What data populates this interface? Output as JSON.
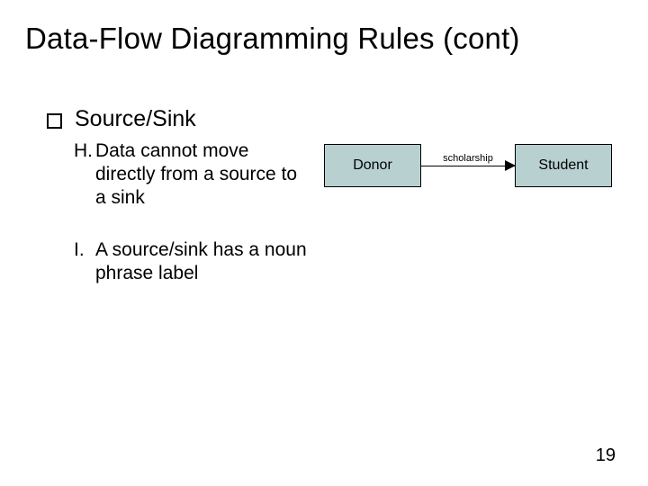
{
  "title": "Data-Flow Diagramming Rules (cont)",
  "bullet": {
    "label": "Source/Sink"
  },
  "items": {
    "H": {
      "letter": "H.",
      "text": "Data cannot move directly from a source to a sink"
    },
    "I": {
      "letter": "I.",
      "text": "A source/sink has a noun phrase label"
    }
  },
  "diagram": {
    "left_box": "Donor",
    "arrow_label": "scholarship",
    "right_box": "Student"
  },
  "page_number": "19"
}
